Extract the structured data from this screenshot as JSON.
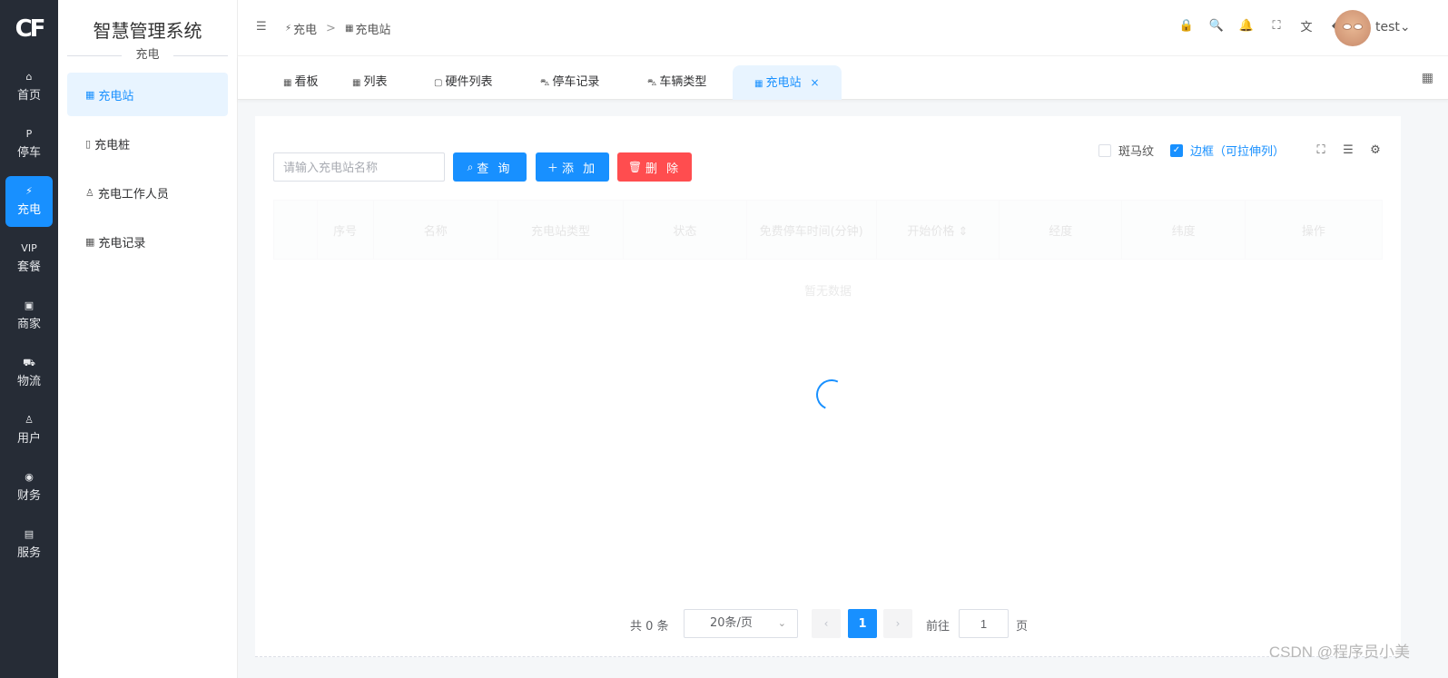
{
  "rail": {
    "logo": "CF",
    "items": [
      {
        "icon": "⌂",
        "label": "首页"
      },
      {
        "icon": "P",
        "label": "停车"
      },
      {
        "icon": "⚡",
        "label": "充电"
      },
      {
        "icon": "VIP",
        "label": "套餐"
      },
      {
        "icon": "▣",
        "label": "商家"
      },
      {
        "icon": "⛟",
        "label": "物流"
      },
      {
        "icon": "♙",
        "label": "用户"
      },
      {
        "icon": "◉",
        "label": "财务"
      },
      {
        "icon": "▤",
        "label": "服务"
      }
    ]
  },
  "sidebar": {
    "title": "智慧管理系统",
    "section": "充电",
    "items": [
      {
        "icon": "▦",
        "label": "充电站"
      },
      {
        "icon": "▯",
        "label": "充电桩"
      },
      {
        "icon": "♙",
        "label": "充电工作人员"
      },
      {
        "icon": "▦",
        "label": "充电记录"
      }
    ]
  },
  "header": {
    "fold_icon": "☰",
    "breadcrumb": [
      {
        "icon": "⚡",
        "label": "充电"
      },
      {
        "separator": ">"
      },
      {
        "icon": "▦",
        "label": "充电站"
      }
    ],
    "tool_icons": [
      "🔒",
      "🔍",
      "🔔",
      "⛶",
      "文",
      "⬖",
      "↻"
    ],
    "username": "test",
    "user_caret": "⌄"
  },
  "tabs": {
    "items": [
      {
        "icon": "▦",
        "label": "看板"
      },
      {
        "icon": "▦",
        "label": "列表"
      },
      {
        "icon": "▢",
        "label": "硬件列表"
      },
      {
        "icon": "⛍",
        "label": "停车记录"
      },
      {
        "icon": "⛍",
        "label": "车辆类型"
      },
      {
        "icon": "▦",
        "label": "充电站",
        "close": "×"
      }
    ],
    "menu_icon": "▦"
  },
  "toolbar": {
    "search_placeholder": "请输入充电站名称",
    "query_label": "查 询",
    "add_label": "添 加",
    "delete_label": "删 除",
    "stripe_label": "斑马纹",
    "border_label": "边框（可拉伸列）",
    "stripe_checked": false,
    "border_checked": true
  },
  "table": {
    "columns": [
      "",
      "序号",
      "名称",
      "充电站类型",
      "状态",
      "免费停车时间(分钟)",
      "开始价格 ⇕",
      "经度",
      "纬度",
      "操作"
    ],
    "empty_text": "暂无数据"
  },
  "pagination": {
    "total_text": "共 0 条",
    "page_size": "20条/页",
    "current_page": "1",
    "goto_label": "前往",
    "goto_value": "1",
    "page_suffix": "页"
  },
  "watermark": "CSDN @程序员小美",
  "colors": {
    "primary": "#1890ff",
    "danger": "#ff4d4f",
    "rail_bg": "#262c36"
  }
}
